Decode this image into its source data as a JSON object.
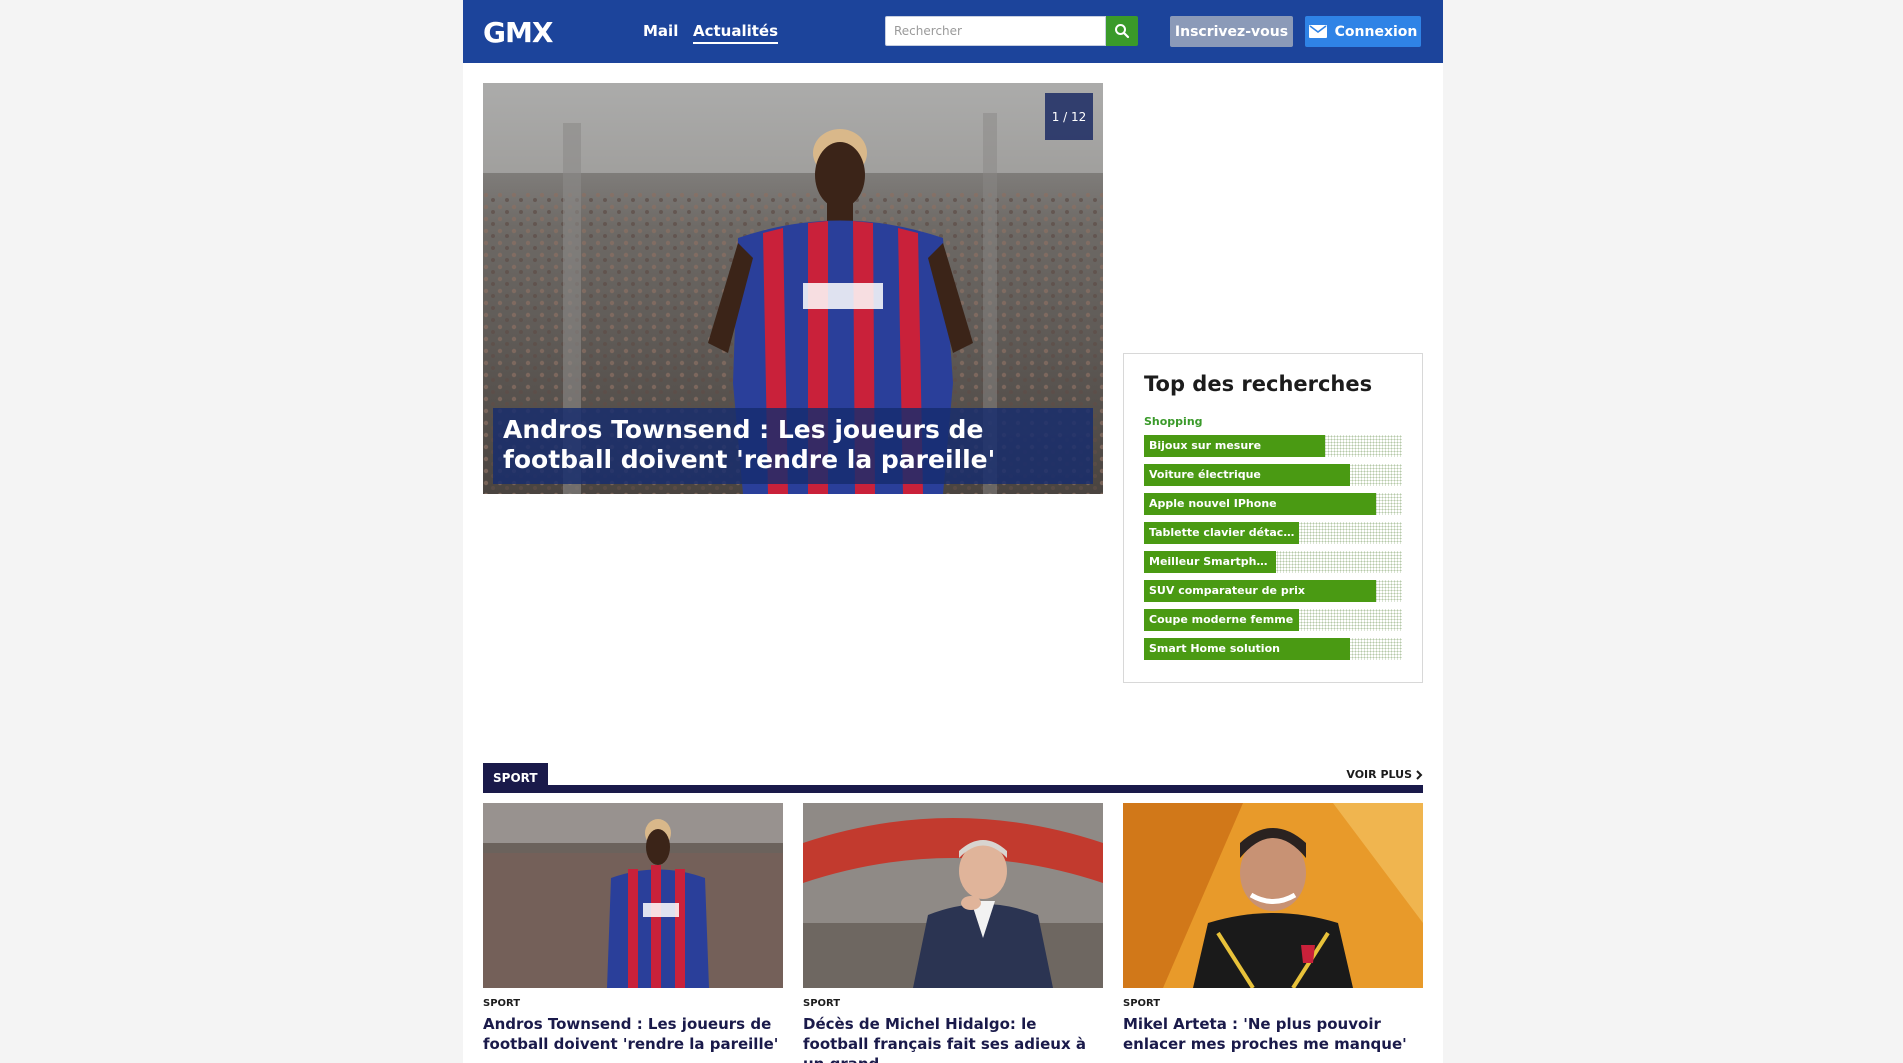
{
  "header": {
    "logo": "GMX",
    "nav": {
      "mail": "Mail",
      "news": "Actualités"
    },
    "search": {
      "placeholder": "Rechercher"
    },
    "signup": "Inscrivez-vous",
    "login": "Connexion"
  },
  "hero": {
    "counter": "1 / 12",
    "headline": "Andros Townsend : Les joueurs de football doivent 'rendre la pareille'"
  },
  "top_searches": {
    "title": "Top des recherches",
    "category": "Shopping",
    "items": [
      {
        "label": "Bijoux sur mesure",
        "score": 0.7
      },
      {
        "label": "Voiture électrique",
        "score": 0.8
      },
      {
        "label": "Apple nouvel IPhone",
        "score": 0.9
      },
      {
        "label": "Tablette clavier détachable",
        "score": 0.6
      },
      {
        "label": "Meilleur Smartphone",
        "score": 0.51
      },
      {
        "label": "SUV comparateur de prix",
        "score": 0.9
      },
      {
        "label": "Coupe moderne femme",
        "score": 0.6
      },
      {
        "label": "Smart Home solution",
        "score": 0.8
      }
    ]
  },
  "section": {
    "label": "SPORT",
    "more": "VOIR PLUS",
    "cards": [
      {
        "category": "SPORT",
        "title": "Andros Townsend : Les joueurs de football doivent 'rendre la pareille'"
      },
      {
        "category": "SPORT",
        "title": "Décès de Michel Hidalgo: le football français fait ses adieux à un grand"
      },
      {
        "category": "SPORT",
        "title": "Mikel Arteta : 'Ne plus pouvoir enlacer mes proches me manque'"
      }
    ]
  },
  "colors": {
    "header": "#1c449b",
    "accent_green": "#4a9a13",
    "section_navy": "#1a1a4a",
    "login_blue": "#2f83e6"
  }
}
